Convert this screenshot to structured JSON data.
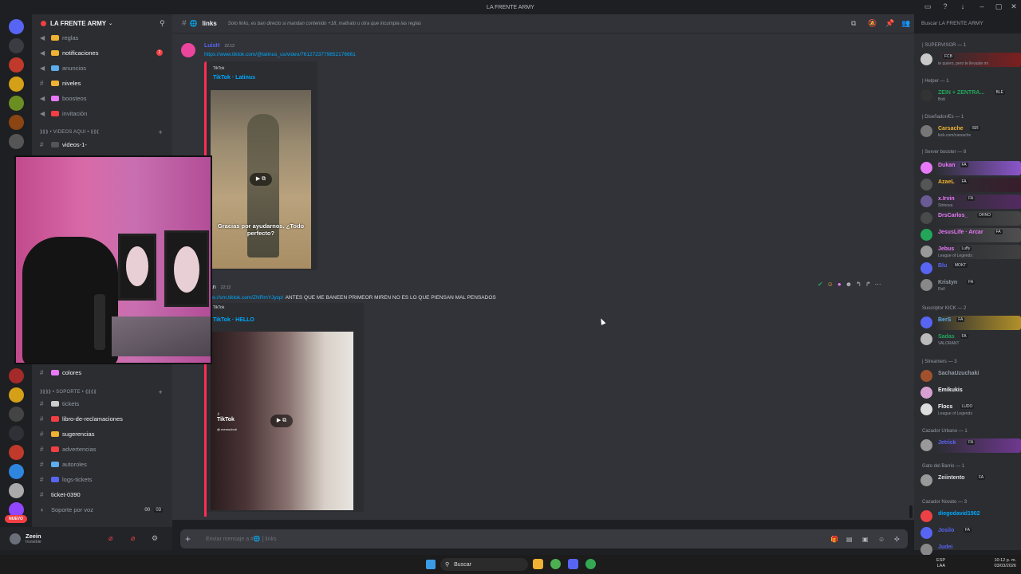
{
  "titlebar": {
    "title": "LA FRENTE ARMY"
  },
  "sidebar": {
    "guild_name": "LA FRENTE ARMY",
    "channels": [
      {
        "name": "reglas",
        "unread": false
      },
      {
        "name": "notificaciones",
        "unread": true,
        "badge": "2"
      },
      {
        "name": "anuncios",
        "unread": false
      },
      {
        "name": "niveles",
        "unread": true
      },
      {
        "name": "boosteos",
        "unread": false
      },
      {
        "name": "invitación",
        "unread": false
      }
    ],
    "category_videos": "⟫⟫⟫ • VIDEOS AQUI • ⟪⟪⟪",
    "videos_channel": "videos-1-",
    "colores": "colores",
    "category_soporte": "⟫⟫⟫⟫ • SOPORTE • ⟪⟪⟪⟪",
    "support_channels": [
      {
        "name": "tickets",
        "unread": false
      },
      {
        "name": "libro-de-reclamaciones",
        "unread": true
      },
      {
        "name": "sugerencias",
        "unread": true
      },
      {
        "name": "advertencias",
        "unread": false
      },
      {
        "name": "autoroles",
        "unread": false
      },
      {
        "name": "logs-tickets",
        "unread": false
      }
    ],
    "ticket": "ticket-0390",
    "voice": "Soporte por voz",
    "voice_count_a": "00",
    "voice_count_b": "03"
  },
  "user": {
    "name": "Zeein",
    "status": "Invisible"
  },
  "new_badge": "NUEVO",
  "header": {
    "channel": "links",
    "topic": "Solo links, es ban directo si mandan contenido +18, maltrato u otra que incumpla las reglas"
  },
  "search": {
    "placeholder": "Buscar LA FRENTE ARMY"
  },
  "messages": [
    {
      "author": "LuisH",
      "time": "22:12",
      "link": "https://www.tiktok.com/@latinus_us/video/7612723779852176661",
      "embed_provider": "TikTok",
      "embed_title": "TikTok · Latinus",
      "caption": "Gracias por ayudarnos. ¿Todo perfecto?"
    },
    {
      "author": "ryan",
      "time": "22:12",
      "link": "https://vm.tiktok.com/ZNRmYJycp/",
      "text": "ANTES QUE ME BANEEN PRIMEOR MIREN NO ES LO QUE PIENSAN MAL PENSADOS",
      "embed_provider": "TikTok",
      "embed_title": "TikTok · HELLO",
      "watermark": "TikTok",
      "watermark_user": "@ memochoti"
    }
  ],
  "composer": {
    "placeholder": "Enviar mensaje a #🌐 ] links"
  },
  "members": {
    "roles": [
      {
        "label": "| SUPERVISOR — 1"
      },
      {
        "label": "| Helper — 1"
      },
      {
        "label": "| DiseñadorÆs — 1"
      },
      {
        "label": "| Server booster — 8"
      },
      {
        "label": "Suscriptor KICK — 2"
      },
      {
        "label": "| Streamers — 3"
      },
      {
        "label": "Cazador Urbano — 1"
      },
      {
        "label": "Gato del Barrio — 1"
      },
      {
        "label": "Cazador Novato — 3"
      }
    ],
    "list": [
      {
        "name": "",
        "tag": "FCB",
        "status": "te quiero, pero te llevaste mi",
        "color": "#f23f43"
      },
      {
        "name": "ZEIN + ZENTRA...",
        "tag": "BLE",
        "status": "Bott",
        "color": "#23a55a"
      },
      {
        "name": "Carsache",
        "tag": "ISR",
        "status": "kick.com/carsache",
        "color": "#f0b232"
      },
      {
        "name": "Dukan",
        "tag": "FA",
        "status": "",
        "color": "#e879f9"
      },
      {
        "name": "AzaeL",
        "tag": "FA",
        "status": "",
        "color": "#f0b232"
      },
      {
        "name": "x.Irvin",
        "tag": "FA",
        "status": "Strinova",
        "color": "#e879f9"
      },
      {
        "name": "DrsCarlos_",
        "tag": "OHNO",
        "status": "",
        "color": "#e879f9"
      },
      {
        "name": "JesusLife · Arcar",
        "tag": "FA",
        "status": "",
        "color": "#e879f9"
      },
      {
        "name": "Jebus",
        "tag": "Luffy",
        "status": "League of Legends",
        "color": "#e879f9"
      },
      {
        "name": "Blu",
        "tag": "MOKT",
        "status": "",
        "color": "#5865f2"
      },
      {
        "name": "Kristyn",
        "tag": "FA",
        "status": "Roll",
        "color": "#949ba4"
      },
      {
        "name": "BerS",
        "tag": "FA",
        "status": "",
        "color": "#5dadec"
      },
      {
        "name": "Sadas",
        "tag": "FA",
        "status": "VALORANT",
        "color": "#23a55a"
      },
      {
        "name": "SachaUzuchaki",
        "tag": "",
        "status": "",
        "color": "#949ba4"
      },
      {
        "name": "Emikukis",
        "tag": "",
        "status": "",
        "color": "#f2f3f5"
      },
      {
        "name": "Flocs",
        "tag": "LUDO",
        "status": "League of Legends",
        "color": "#f2f3f5"
      },
      {
        "name": "Jetrick",
        "tag": "FA",
        "status": "",
        "color": "#5865f2"
      },
      {
        "name": "Zeiintento",
        "tag": "FA",
        "status": "",
        "color": "#dbdee1"
      },
      {
        "name": "diegodavid1902",
        "tag": "",
        "status": "",
        "color": "#00a8fc"
      },
      {
        "name": "Josilo",
        "tag": "FA",
        "status": "",
        "color": "#5865f2"
      },
      {
        "name": "Judei",
        "tag": "",
        "status": "",
        "color": "#5865f2"
      }
    ]
  },
  "taskbar": {
    "search": "Buscar",
    "lang": "ESP",
    "lang2": "LAA",
    "time": "10:12 p. m.",
    "date": "03/03/2026"
  },
  "colors": {
    "accent": "#5865f2",
    "link": "#00a8fc",
    "tiktok": "#fe2c55"
  }
}
